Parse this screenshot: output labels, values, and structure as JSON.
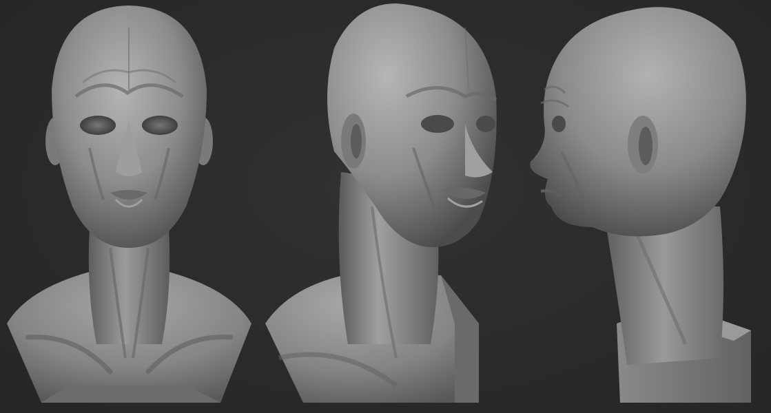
{
  "scene": {
    "background_color": "#2b2b2b",
    "clay_color": "#8a8a8a",
    "views": [
      {
        "name": "front",
        "icon": "clay-bust-front"
      },
      {
        "name": "three-quarter",
        "icon": "clay-bust-three-quarter"
      },
      {
        "name": "profile",
        "icon": "clay-bust-profile"
      }
    ]
  }
}
